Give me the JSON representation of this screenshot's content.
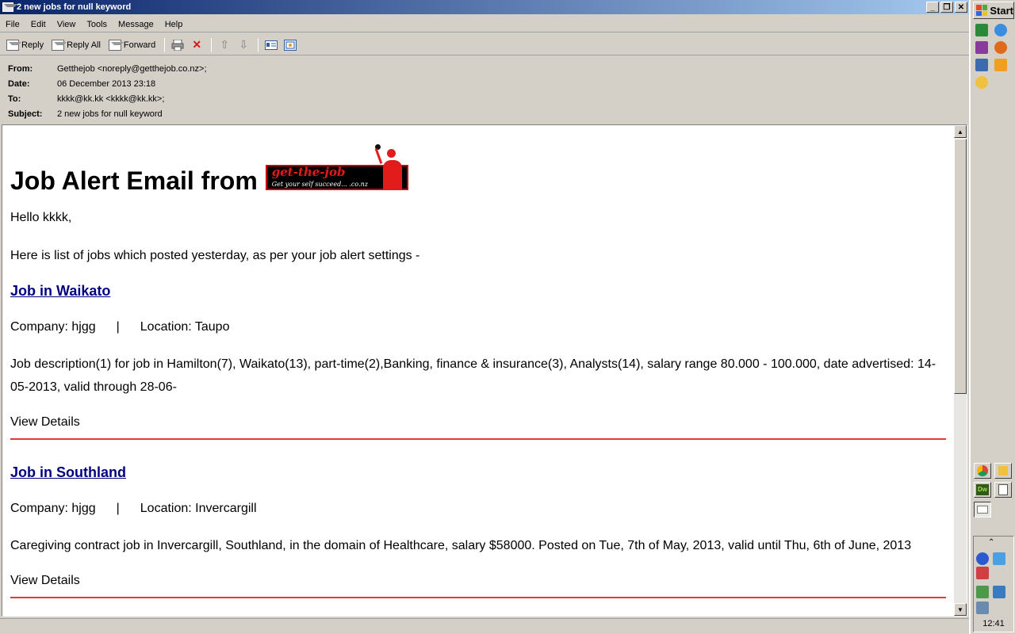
{
  "window": {
    "title": "2 new jobs for null keyword"
  },
  "menu": [
    "File",
    "Edit",
    "View",
    "Tools",
    "Message",
    "Help"
  ],
  "toolbar": {
    "reply": "Reply",
    "reply_all": "Reply All",
    "forward": "Forward"
  },
  "headers": {
    "from_label": "From:",
    "from": "Getthejob <noreply@getthejob.co.nz>;",
    "date_label": "Date:",
    "date": "06 December 2013 23:18",
    "to_label": "To:",
    "to": "kkkk@kk.kk <kkkk@kk.kk>;",
    "subject_label": "Subject:",
    "subject": "2 new jobs for null keyword"
  },
  "email": {
    "heading": "Job Alert Email from",
    "logo_text": "get-the-job",
    "logo_sub": "Get your self succeed... .co.nz",
    "greeting": "Hello kkkk,",
    "intro": "Here is list of jobs which posted yesterday, as per your job alert settings -",
    "jobs": [
      {
        "title": "Job in Waikato",
        "company": "Company: hjgg",
        "separator": "|",
        "location": "Location: Taupo",
        "description": "Job description(1) for job in Hamilton(7), Waikato(13), part-time(2),Banking, finance & insurance(3), Analysts(14), salary range 80.000 - 100.000, date advertised: 14-05-2013, valid through 28-06-",
        "view": "View Details"
      },
      {
        "title": "Job in Southland",
        "company": "Company: hjgg",
        "separator": "|",
        "location": "Location: Invercargill",
        "description": "Caregiving contract job in Invercargill, Southland, in the domain of Healthcare, salary $58000. Posted on Tue, 7th of May, 2013, valid until Thu, 6th of June, 2013",
        "view": "View Details"
      }
    ]
  },
  "taskbar": {
    "start": "Start",
    "clock": "12:41"
  },
  "colors": {
    "divider": "#e53935",
    "link": "#000080",
    "title_bar_start": "#0a246a"
  }
}
